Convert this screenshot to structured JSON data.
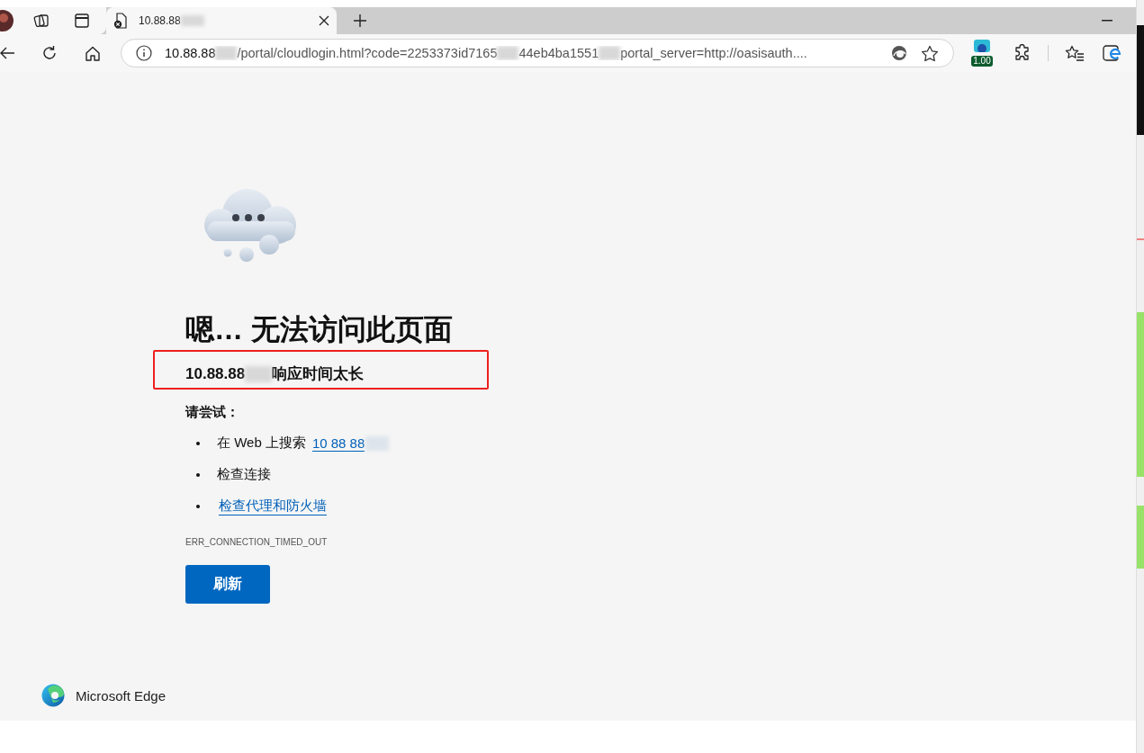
{
  "tab": {
    "title": "10.88.88",
    "selected": true
  },
  "address_bar": {
    "url_parts": [
      "10.88.88",
      "/portal/cloudlogin.html?code=2253373id7165",
      "44eb4ba1551",
      "portal_server=http://oasisauth...."
    ]
  },
  "extension_badge": "1.00",
  "error_page": {
    "heading": "嗯… 无法访问此页面",
    "host": "10.88.88",
    "message": "响应时间太长",
    "try_label": "请尝试：",
    "suggestions": [
      {
        "kind": "search",
        "text": "在 Web 上搜索",
        "link": "10 88 88"
      },
      {
        "kind": "plain",
        "text": "检查连接"
      },
      {
        "kind": "link",
        "link": "检查代理和防火墙"
      }
    ],
    "error_code": "ERR_CONNECTION_TIMED_OUT",
    "button": "刷新"
  },
  "footer": {
    "brand": "Microsoft Edge"
  }
}
